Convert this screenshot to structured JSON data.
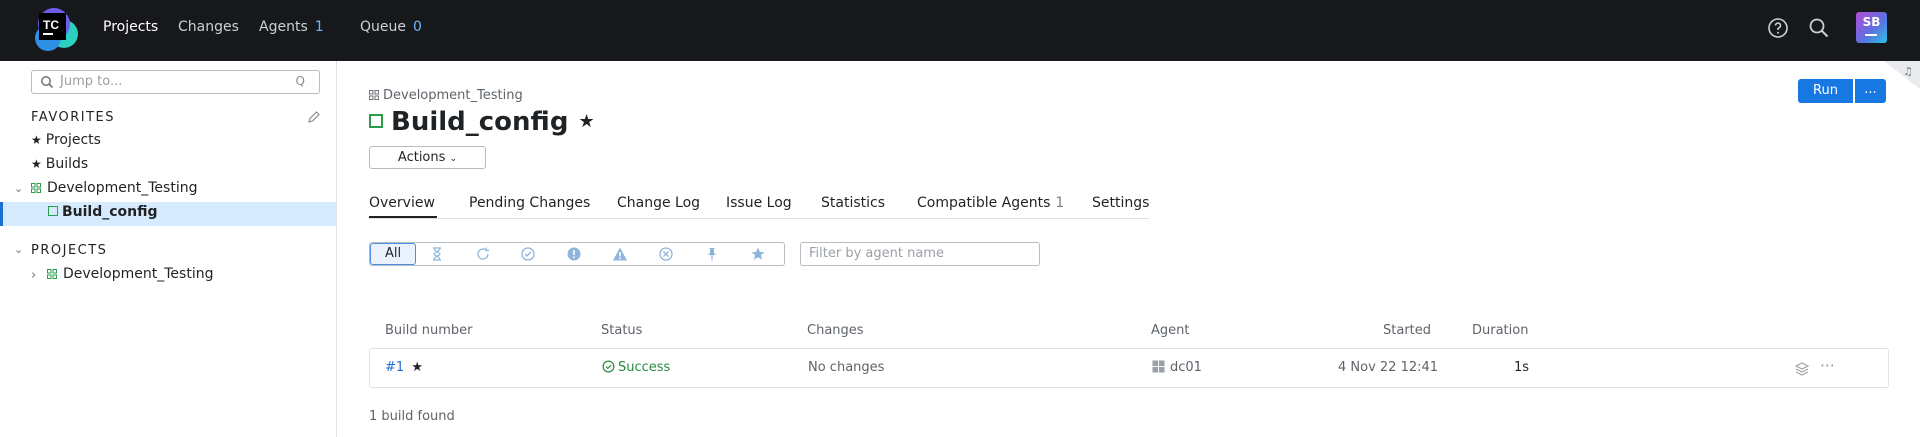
{
  "topbar": {
    "logo_text": "TC",
    "nav": [
      {
        "label": "Projects"
      },
      {
        "label": "Changes"
      },
      {
        "label": "Agents",
        "count": "1"
      },
      {
        "label": "Queue",
        "count": "0"
      }
    ],
    "avatar_initials": "SB",
    "icons": [
      "help-icon",
      "search-icon"
    ]
  },
  "sidebar": {
    "search_placeholder": "Jump to...",
    "search_shortcut": "Q",
    "favorites_heading": "FAVORITES",
    "favorites": [
      {
        "label": "Projects"
      },
      {
        "label": "Builds"
      },
      {
        "label": "Development_Testing"
      },
      {
        "label": "Build_config"
      }
    ],
    "projects_heading": "PROJECTS",
    "projects": [
      {
        "label": "Development_Testing"
      }
    ]
  },
  "main": {
    "breadcrumb": "Development_Testing",
    "title": "Build_config",
    "actions_label": "Actions",
    "run_label": "Run",
    "more_label": "...",
    "tabs": [
      {
        "label": "Overview"
      },
      {
        "label": "Pending Changes"
      },
      {
        "label": "Change Log"
      },
      {
        "label": "Issue Log"
      },
      {
        "label": "Statistics"
      },
      {
        "label": "Compatible Agents",
        "count": "1"
      },
      {
        "label": "Settings"
      }
    ],
    "filter_all_label": "All",
    "filter_icons": [
      "hourglass-icon",
      "running-icon",
      "success-icon",
      "error-icon",
      "warning-icon",
      "cancelled-icon",
      "pin-icon",
      "star-icon"
    ],
    "agent_filter_placeholder": "Filter by agent name",
    "columns": {
      "build_number": "Build number",
      "status": "Status",
      "changes": "Changes",
      "agent": "Agent",
      "started": "Started",
      "duration": "Duration"
    },
    "builds": [
      {
        "number": "#1",
        "status": "Success",
        "changes": "No changes",
        "agent": "dc01",
        "started": "4 Nov 22 12:41",
        "duration": "1s"
      }
    ],
    "found_text": "1 build found"
  },
  "colors": {
    "topbar_bg": "#17181b",
    "accent": "#1678e0",
    "success": "#2b9e4c",
    "selected_bg": "#d6ebfd"
  }
}
